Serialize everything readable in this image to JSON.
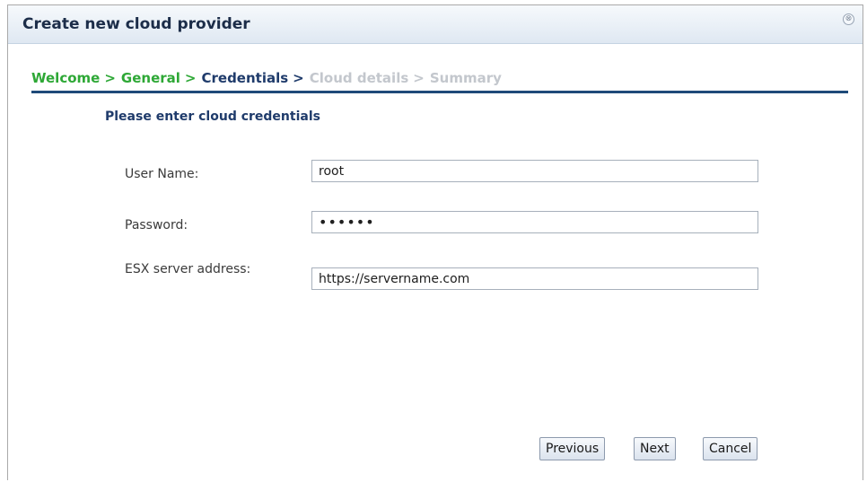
{
  "dialog": {
    "title": "Create new cloud provider",
    "close_icon_glyph": "⊗"
  },
  "breadcrumb": {
    "steps": [
      {
        "label": "Welcome",
        "state": "done"
      },
      {
        "label": "General",
        "state": "done"
      },
      {
        "label": "Credentials",
        "state": "current"
      },
      {
        "label": "Cloud details",
        "state": "future"
      },
      {
        "label": "Summary",
        "state": "future"
      }
    ],
    "separator": ">"
  },
  "form": {
    "heading": "Please enter cloud credentials",
    "username": {
      "label": "User Name:",
      "value": "root"
    },
    "password": {
      "label": "Password:",
      "value": "••••••"
    },
    "server": {
      "label": "ESX server address:",
      "value": "https://servername.com"
    }
  },
  "buttons": {
    "previous": "Previous",
    "next": "Next",
    "cancel": "Cancel"
  },
  "colors": {
    "done": "#2ea836",
    "current": "#1f3b6b",
    "future": "#c3c7cd",
    "rule": "#1f4a79"
  }
}
